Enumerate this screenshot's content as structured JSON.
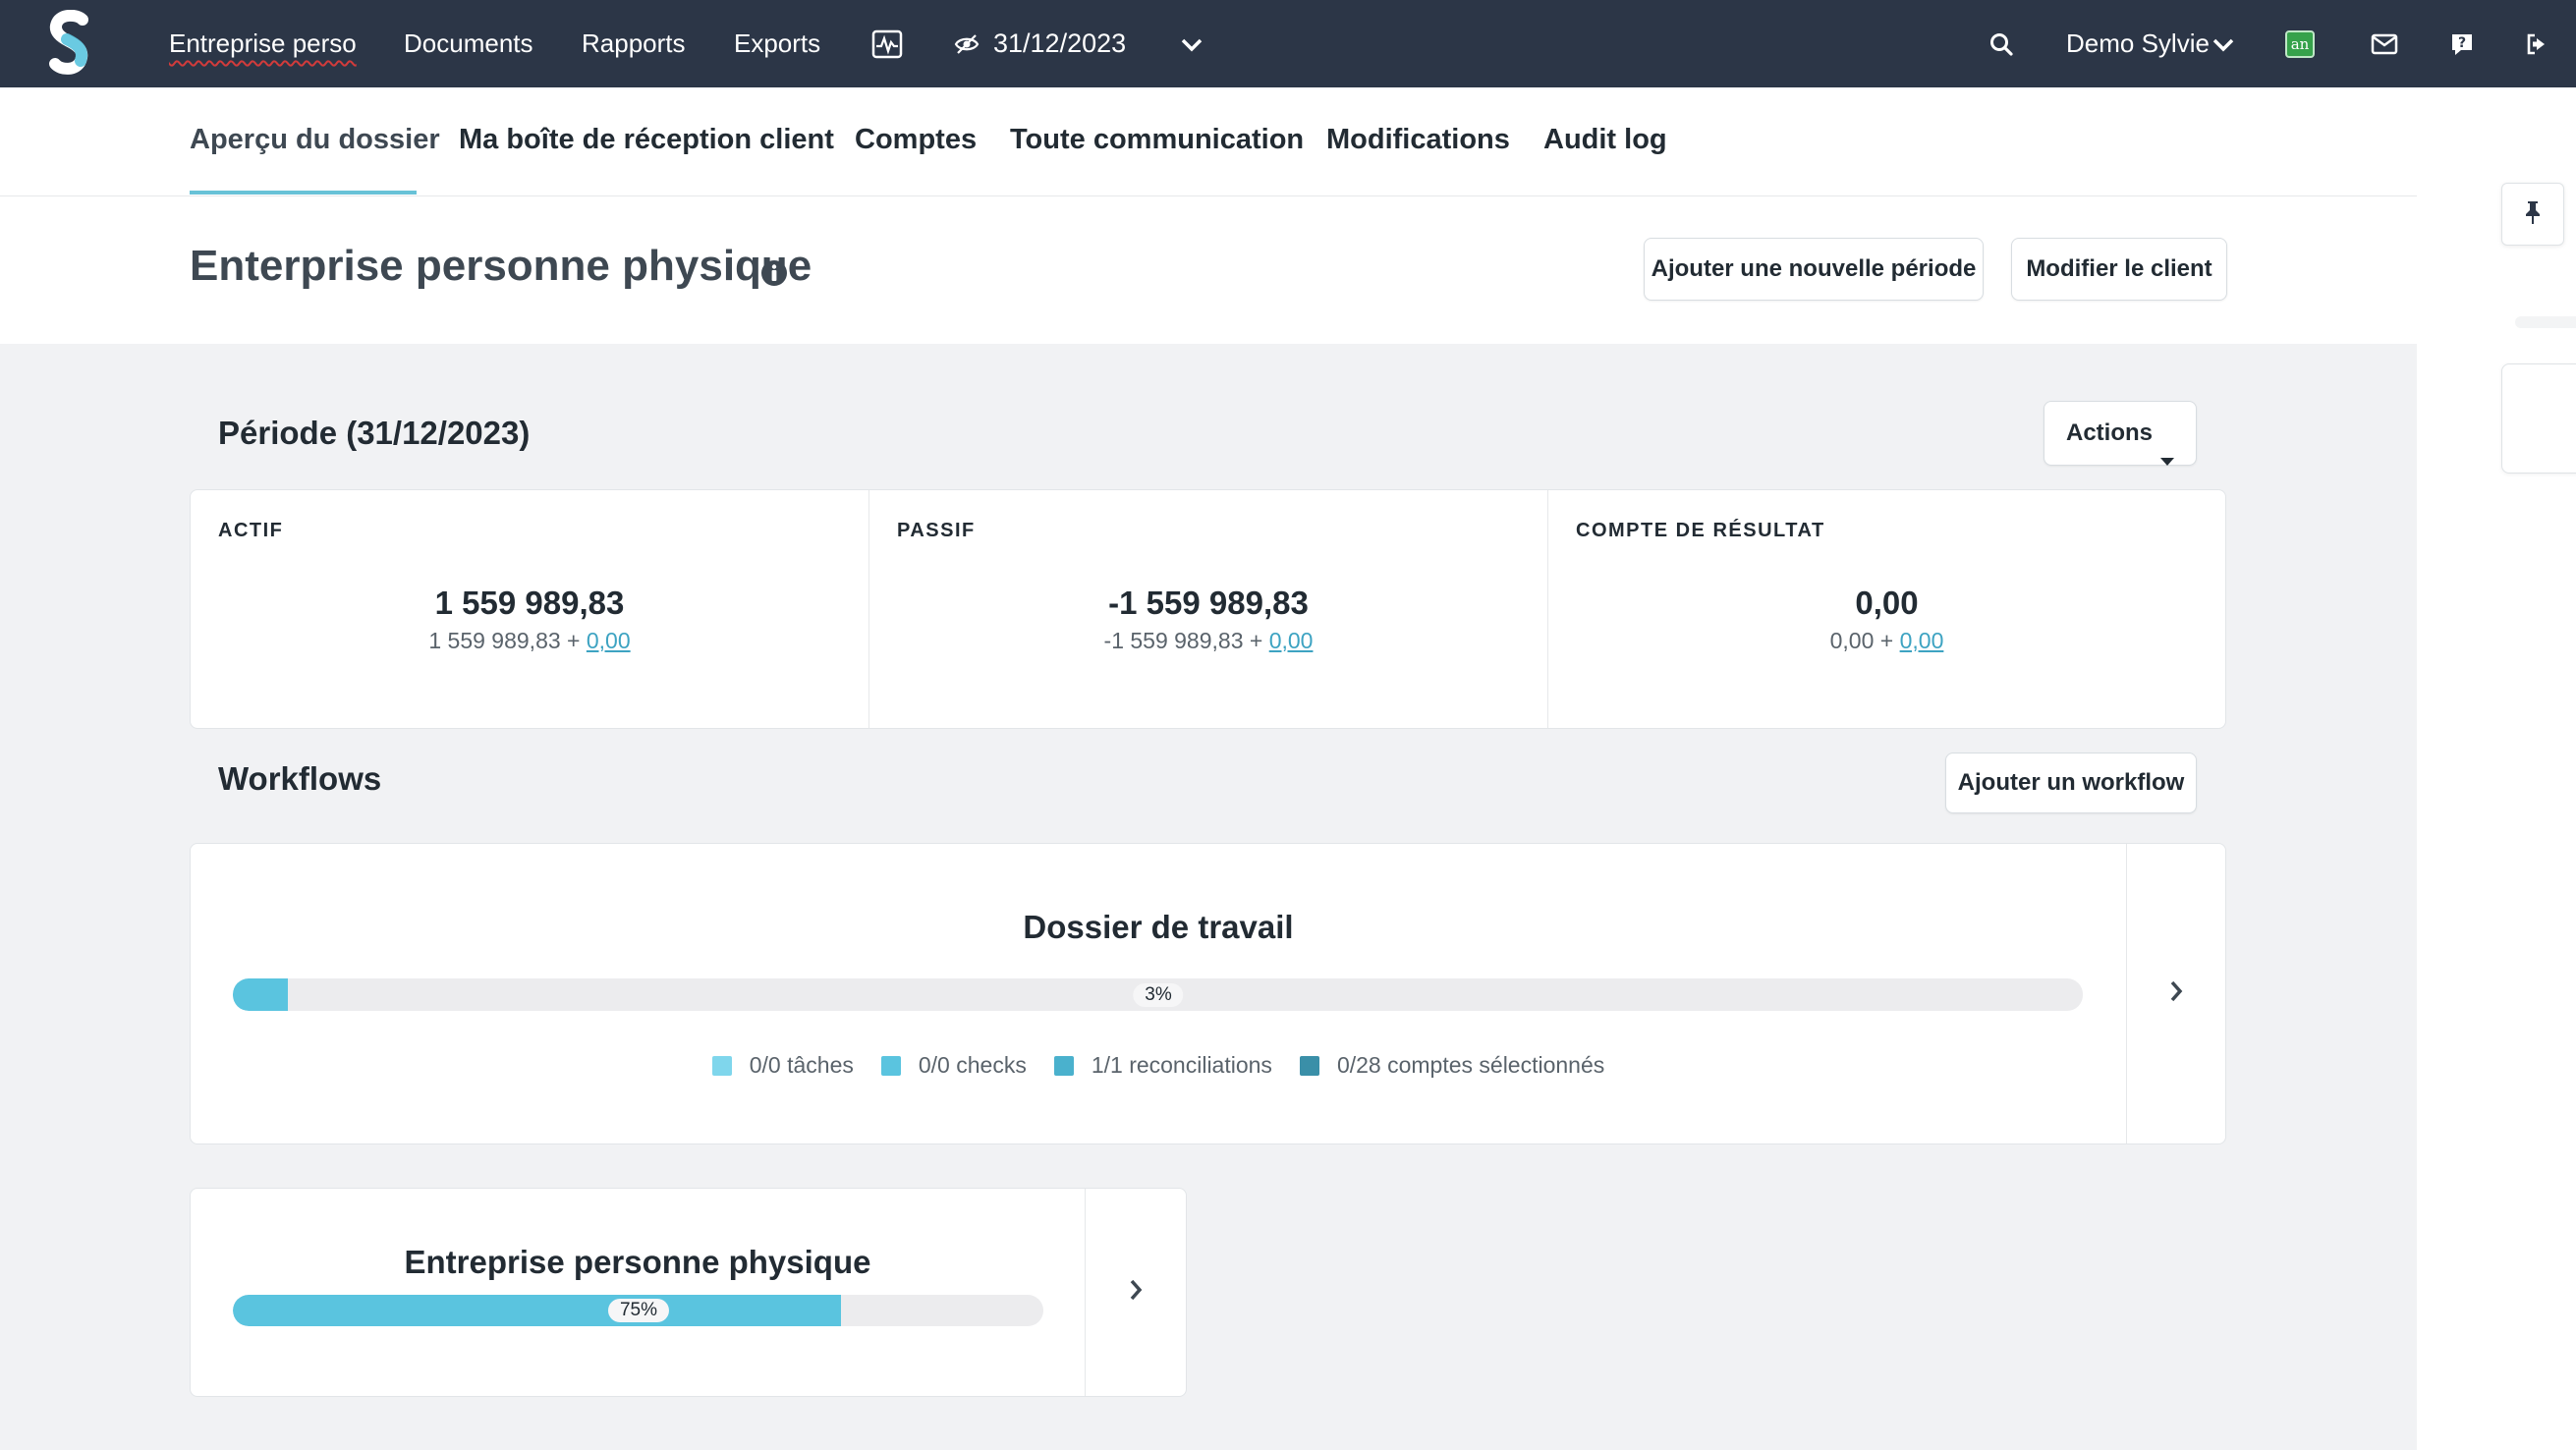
{
  "navbar": {
    "logo_icon": "silverfin-logo-icon",
    "client_link": "Entreprise perso",
    "links": [
      "Documents",
      "Rapports",
      "Exports"
    ],
    "activity_icon": "activity-chart-icon",
    "period_icon": "eye-slash-icon",
    "period_date": "31/12/2023",
    "period_dropdown_icon": "chevron-down-icon",
    "search_icon": "search-icon",
    "user_name": "Demo Sylvie",
    "user_dropdown_icon": "chevron-down-icon",
    "app_badge": "an",
    "mail_icon": "envelope-icon",
    "help_icon": "question-icon",
    "logout_icon": "sign-out-icon",
    "background_color": "#2c3647"
  },
  "tabs": [
    {
      "label": "Aperçu du dossier",
      "active": true
    },
    {
      "label": "Ma boîte de réception client",
      "active": false
    },
    {
      "label": "Comptes",
      "active": false
    },
    {
      "label": "Toute communication",
      "active": false
    },
    {
      "label": "Modifications",
      "active": false
    },
    {
      "label": "Audit log",
      "active": false
    }
  ],
  "client": {
    "title": "Enterprise personne physique",
    "info_icon": "info-circle-icon",
    "add_period_button": "Ajouter une nouvelle période",
    "edit_client_button": "Modifier le client"
  },
  "period": {
    "title": "Période (31/12/2023)",
    "actions_button": "Actions",
    "actions_icon": "caret-down-icon",
    "summary": [
      {
        "label": "ACTIF",
        "value": "1 559 989,83",
        "base": "1 559 989,83 +",
        "adjustment": "0,00"
      },
      {
        "label": "PASSIF",
        "value": "-1 559 989,83",
        "base": "-1 559 989,83 +",
        "adjustment": "0,00"
      },
      {
        "label": "COMPTE DE RÉSULTAT",
        "value": "0,00",
        "base": "0,00 +",
        "adjustment": "0,00"
      }
    ]
  },
  "workflows": {
    "title": "Workflows",
    "add_button": "Ajouter un workflow",
    "items": [
      {
        "title": "Dossier de travail",
        "progress": 0.03,
        "progress_label": "3%",
        "legend": [
          {
            "label": "0/0 tâches",
            "color": "#7fd6ec"
          },
          {
            "label": "0/0 checks",
            "color": "#5ac4df"
          },
          {
            "label": "1/1 reconciliations",
            "color": "#4ab1cd"
          },
          {
            "label": "0/28 comptes sélectionnés",
            "color": "#3a8fa8"
          }
        ],
        "arrow_icon": "chevron-right-icon"
      },
      {
        "title": "Entreprise personne physique",
        "progress": 0.75,
        "progress_label": "75%",
        "arrow_icon": "chevron-right-icon"
      }
    ]
  },
  "sidebar": {
    "pin_icon": "thumbtack-icon"
  },
  "colors": {
    "accent": "#68c2d7",
    "progress": "#5ac4df",
    "link": "#3da3c2",
    "page_background": "#f1f2f4"
  }
}
